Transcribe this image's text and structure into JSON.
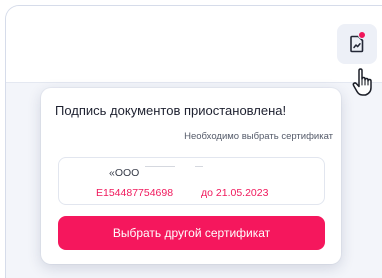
{
  "notification": {
    "icon": "document-chart-icon",
    "badge_color": "#f0165a"
  },
  "popover": {
    "title": "Подпись документов приостановлена!",
    "hint": "Необходимо выбрать сертификат",
    "certificate": {
      "organization": "«ООО",
      "number": "E154487754698",
      "valid_until": "до 21.05.2023"
    },
    "select_button_label": "Выбрать другой сертификат"
  },
  "colors": {
    "accent": "#f5175d",
    "text": "#1e2130"
  }
}
